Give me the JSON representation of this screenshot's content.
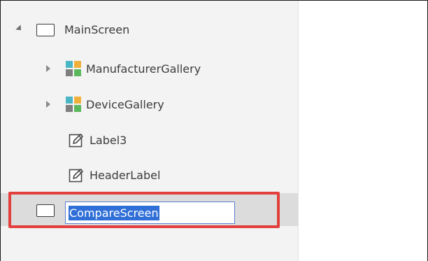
{
  "tree": {
    "items": [
      {
        "label": "MainScreen",
        "icon": "screen-icon",
        "expander": "expanded"
      },
      {
        "label": "ManufacturerGallery",
        "icon": "gallery-icon",
        "expander": "collapsed"
      },
      {
        "label": "DeviceGallery",
        "icon": "gallery-icon",
        "expander": "collapsed"
      },
      {
        "label": "Label3",
        "icon": "label-icon",
        "expander": "none"
      },
      {
        "label": "HeaderLabel",
        "icon": "label-icon",
        "expander": "none"
      }
    ],
    "editing_item": {
      "value": "CompareScreen",
      "icon": "screen-icon"
    }
  },
  "colors": {
    "pane_background": "#f3f3f3",
    "selected_row": "#dcdcdc",
    "text_selection": "#2f6fd7",
    "callout_border": "#e2403d",
    "gallery_teal": "#4bb7c4",
    "gallery_orange": "#f0b13c",
    "gallery_green": "#5cb85c",
    "gallery_gray": "#7f7f7f"
  }
}
